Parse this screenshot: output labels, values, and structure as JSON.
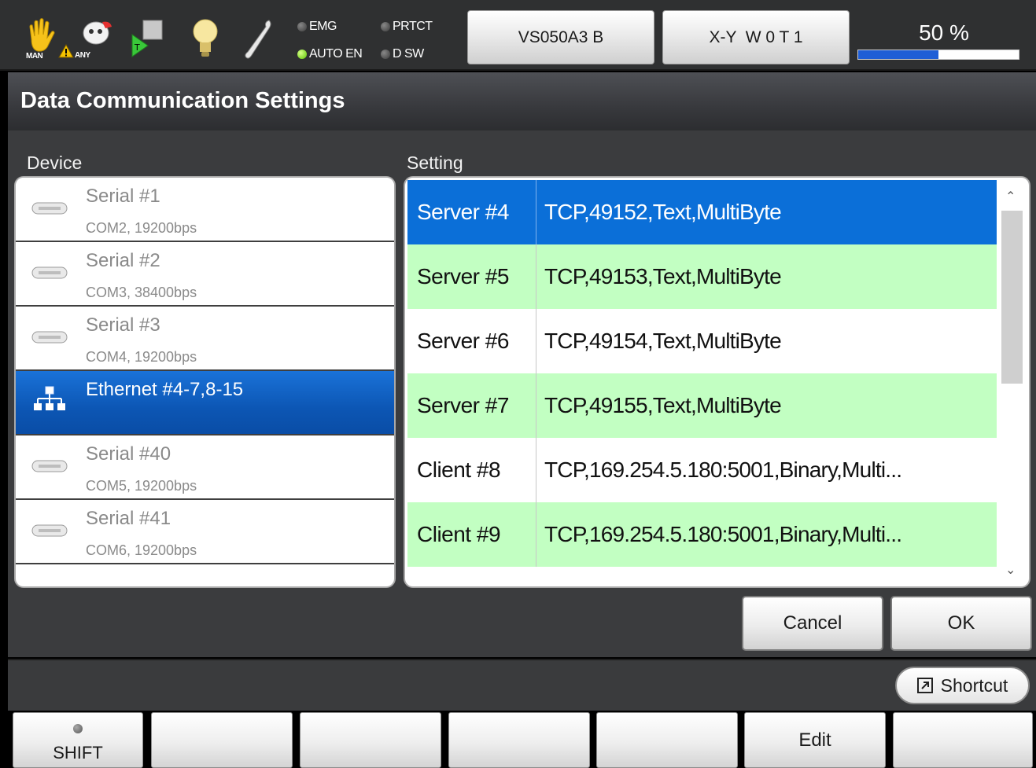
{
  "status_bar": {
    "mode_label": "MAN",
    "any_label": "ANY",
    "leds": [
      {
        "label": "EMG",
        "state": "off"
      },
      {
        "label": "PRTCT",
        "state": "off"
      },
      {
        "label": "AUTO EN",
        "state": "on"
      },
      {
        "label": "D SW",
        "state": "off"
      }
    ],
    "robot_button": "VS050A3 B",
    "coord_button": "X-Y  W 0 T 1",
    "speed_label": "50 %",
    "speed_fraction": 0.5
  },
  "title": "Data Communication Settings",
  "device": {
    "label": "Device",
    "items": [
      {
        "name": "Serial #1",
        "detail": "COM2, 19200bps",
        "type": "serial",
        "selected": false
      },
      {
        "name": "Serial #2",
        "detail": "COM3, 38400bps",
        "type": "serial",
        "selected": false
      },
      {
        "name": "Serial #3",
        "detail": "COM4, 19200bps",
        "type": "serial",
        "selected": false
      },
      {
        "name": "Ethernet #4-7,8-15",
        "detail": "",
        "type": "ethernet",
        "selected": true
      },
      {
        "name": "Serial #40",
        "detail": "COM5, 19200bps",
        "type": "serial",
        "selected": false
      },
      {
        "name": "Serial #41",
        "detail": "COM6, 19200bps",
        "type": "serial",
        "selected": false
      }
    ]
  },
  "setting": {
    "label": "Setting",
    "rows": [
      {
        "name": "Server #4",
        "value": "TCP,49152,Text,MultiByte",
        "style": "selected"
      },
      {
        "name": "Server #5",
        "value": "TCP,49153,Text,MultiByte",
        "style": "green"
      },
      {
        "name": "Server #6",
        "value": "TCP,49154,Text,MultiByte",
        "style": "white"
      },
      {
        "name": "Server #7",
        "value": "TCP,49155,Text,MultiByte",
        "style": "green"
      },
      {
        "name": "Client #8",
        "value": "TCP,169.254.5.180:5001,Binary,Multi...",
        "style": "white"
      },
      {
        "name": "Client #9",
        "value": "TCP,169.254.5.180:5001,Binary,Multi...",
        "style": "green"
      }
    ]
  },
  "dialog": {
    "cancel": "Cancel",
    "ok": "OK"
  },
  "shortcut": "Shortcut",
  "function_keys": [
    "SHIFT",
    "",
    "",
    "",
    "",
    "Edit",
    ""
  ],
  "colors": {
    "selection": "#0b6fd8",
    "row_alt": "#c2ffc2",
    "speed_fill": "#1f5ed6",
    "led_on": "#5cc400"
  }
}
